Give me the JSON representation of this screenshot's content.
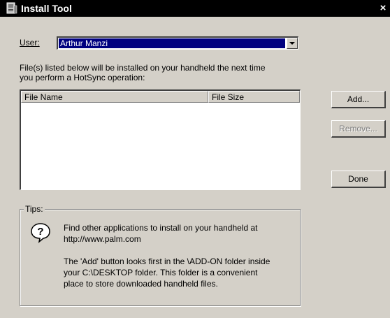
{
  "window": {
    "title": "Install Tool",
    "close_glyph": "×"
  },
  "user": {
    "label": "User:",
    "selected": "Arthur Manzi"
  },
  "instructions": {
    "line1": "File(s) listed below will be installed on your handheld the next time",
    "line2": "you perform a HotSync operation:"
  },
  "file_list": {
    "columns": [
      "File Name",
      "File Size"
    ],
    "rows": []
  },
  "buttons": {
    "add": "Add...",
    "remove": "Remove...",
    "done": "Done"
  },
  "tips": {
    "label": "Tips:",
    "icon": "help-question-icon",
    "tip1": "Find other applications to install on your handheld at\nhttp://www.palm.com",
    "tip2": "The 'Add' button looks first in the \\ADD-ON folder inside\nyour C:\\DESKTOP folder. This folder is a convenient\nplace to store downloaded handheld files."
  },
  "colors": {
    "title_bar": "#000000",
    "face": "#d4d0c8",
    "selection": "#000080"
  }
}
